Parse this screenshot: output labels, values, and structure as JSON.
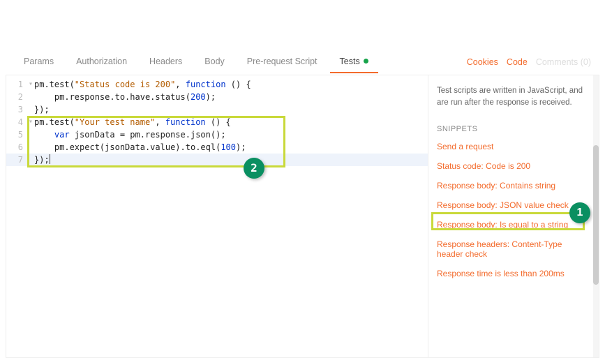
{
  "tabs": {
    "params": "Params",
    "authorization": "Authorization",
    "headers": "Headers",
    "body": "Body",
    "prerequest": "Pre-request Script",
    "tests": "Tests"
  },
  "rightLinks": {
    "cookies": "Cookies",
    "code": "Code",
    "comments": "Comments (0)"
  },
  "code": {
    "l1a": "pm.test(",
    "l1s": "\"Status code is 200\"",
    "l1b": ", ",
    "l1k": "function",
    "l1c": " () {",
    "l2a": "    pm.response.to.have.status(",
    "l2n": "200",
    "l2b": ");",
    "l3": "});",
    "l4a": "pm.test(",
    "l4s": "\"Your test name\"",
    "l4b": ", ",
    "l4k": "function",
    "l4c": " () {",
    "l5a": "    ",
    "l5k": "var",
    "l5b": " jsonData = pm.response.json();",
    "l6a": "    pm.expect(jsonData.value).to.eql(",
    "l6n": "100",
    "l6b": ");",
    "l7": "});"
  },
  "side": {
    "desc": "Test scripts are written in JavaScript, and are run after the response is received.",
    "heading": "SNIPPETS",
    "snippets": [
      "Send a request",
      "Status code: Code is 200",
      "Response body: Contains string",
      "Response body: JSON value check",
      "Response body: Is equal to a string",
      "Response headers: Content-Type header check",
      "Response time is less than 200ms"
    ]
  },
  "anno": {
    "one": "1",
    "two": "2"
  }
}
